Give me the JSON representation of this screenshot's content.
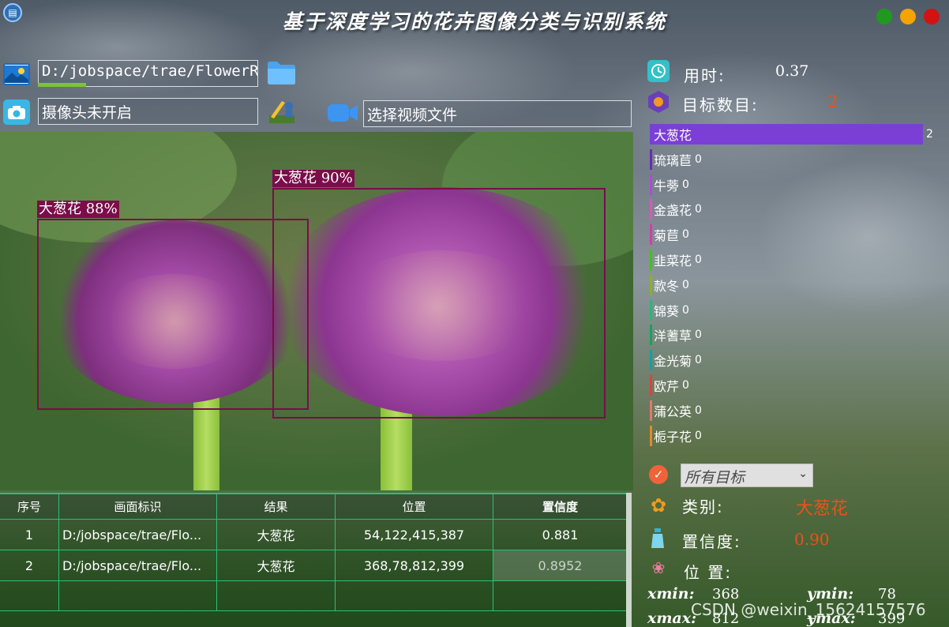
{
  "window": {
    "title": "基于深度学习的花卉图像分类与识别系统",
    "controls": [
      {
        "name": "minimize",
        "color": "#1f9a1f"
      },
      {
        "name": "maximize",
        "color": "#f5a300"
      },
      {
        "name": "close",
        "color": "#d31212"
      }
    ]
  },
  "inputs": {
    "image_path": "D:/jobspace/trae/FlowerRe",
    "camera_status": "摄像头未开启",
    "video_placeholder": "选择视频文件",
    "image_load_progress": 0.22
  },
  "detections": [
    {
      "label": "大葱花 88%"
    },
    {
      "label": "大葱花 90%"
    }
  ],
  "table": {
    "headers": [
      "序号",
      "画面标识",
      "结果",
      "位置",
      "置信度"
    ],
    "rows": [
      [
        "1",
        "D:/jobspace/trae/Flo...",
        "大葱花",
        "54,122,415,387",
        "0.881"
      ],
      [
        "2",
        "D:/jobspace/trae/Flo...",
        "大葱花",
        "368,78,812,399",
        "0.8952"
      ]
    ]
  },
  "stats": {
    "time_label": "用时:",
    "time_value": "0.37",
    "count_label": "目标数目:",
    "count_value": "2"
  },
  "classes": [
    {
      "name": "大葱花",
      "count": "2",
      "color": "#7b3fd6",
      "fraction": 1.0
    },
    {
      "name": "琉璃苣",
      "count": "0",
      "color": "#6a2bb0",
      "fraction": 0
    },
    {
      "name": "牛蒡",
      "count": "0",
      "color": "#b04ad6",
      "fraction": 0
    },
    {
      "name": "金盏花",
      "count": "0",
      "color": "#d65ab8",
      "fraction": 0
    },
    {
      "name": "菊苣",
      "count": "0",
      "color": "#d03fa6",
      "fraction": 0
    },
    {
      "name": "韭菜花",
      "count": "0",
      "color": "#41c21a",
      "fraction": 0
    },
    {
      "name": "款冬",
      "count": "0",
      "color": "#8bb21f",
      "fraction": 0
    },
    {
      "name": "锦葵",
      "count": "0",
      "color": "#27b877",
      "fraction": 0
    },
    {
      "name": "洋蓍草",
      "count": "0",
      "color": "#16a35a",
      "fraction": 0
    },
    {
      "name": "金光菊",
      "count": "0",
      "color": "#0fa1a5",
      "fraction": 0
    },
    {
      "name": "欧芹",
      "count": "0",
      "color": "#d84242",
      "fraction": 0
    },
    {
      "name": "蒲公英",
      "count": "0",
      "color": "#e07a6a",
      "fraction": 0
    },
    {
      "name": "栀子花",
      "count": "0",
      "color": "#e08a2a",
      "fraction": 0
    }
  ],
  "target_select": {
    "value": "所有目标"
  },
  "result": {
    "class_label": "类别:",
    "class_value": "大葱花",
    "conf_label": "置信度:",
    "conf_value": "0.90",
    "pos_label": "位 置:",
    "xmin_label": "xmin:",
    "xmin": "368",
    "ymin_label": "ymin:",
    "ymin": "78",
    "xmax_label": "xmax:",
    "xmax": "812",
    "ymax_label": "ymax:",
    "ymax": "399",
    "value_color": "#e8531a"
  },
  "watermark": "CSDN @weixin_15624157576"
}
